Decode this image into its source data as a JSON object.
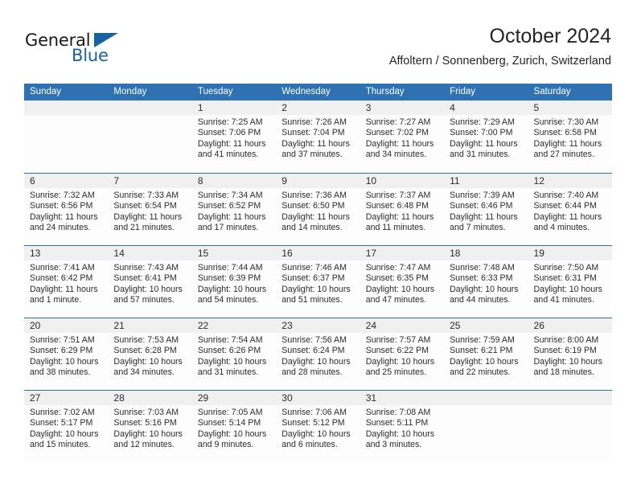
{
  "brand": {
    "name_part1": "General",
    "name_part2": "Blue",
    "accent_color": "#1464a5"
  },
  "header": {
    "title": "October 2024",
    "subtitle": "Affoltern / Sonnenberg, Zurich, Switzerland"
  },
  "theme": {
    "header_blue": "#2f72b4",
    "day_band_gray": "#f0f0f0",
    "text": "#2b2b2b"
  },
  "weekdays": [
    "Sunday",
    "Monday",
    "Tuesday",
    "Wednesday",
    "Thursday",
    "Friday",
    "Saturday"
  ],
  "weeks": [
    [
      {
        "day": "",
        "lines": []
      },
      {
        "day": "",
        "lines": []
      },
      {
        "day": "1",
        "lines": [
          "Sunrise: 7:25 AM",
          "Sunset: 7:06 PM",
          "Daylight: 11 hours",
          "and 41 minutes."
        ]
      },
      {
        "day": "2",
        "lines": [
          "Sunrise: 7:26 AM",
          "Sunset: 7:04 PM",
          "Daylight: 11 hours",
          "and 37 minutes."
        ]
      },
      {
        "day": "3",
        "lines": [
          "Sunrise: 7:27 AM",
          "Sunset: 7:02 PM",
          "Daylight: 11 hours",
          "and 34 minutes."
        ]
      },
      {
        "day": "4",
        "lines": [
          "Sunrise: 7:29 AM",
          "Sunset: 7:00 PM",
          "Daylight: 11 hours",
          "and 31 minutes."
        ]
      },
      {
        "day": "5",
        "lines": [
          "Sunrise: 7:30 AM",
          "Sunset: 6:58 PM",
          "Daylight: 11 hours",
          "and 27 minutes."
        ]
      }
    ],
    [
      {
        "day": "6",
        "lines": [
          "Sunrise: 7:32 AM",
          "Sunset: 6:56 PM",
          "Daylight: 11 hours",
          "and 24 minutes."
        ]
      },
      {
        "day": "7",
        "lines": [
          "Sunrise: 7:33 AM",
          "Sunset: 6:54 PM",
          "Daylight: 11 hours",
          "and 21 minutes."
        ]
      },
      {
        "day": "8",
        "lines": [
          "Sunrise: 7:34 AM",
          "Sunset: 6:52 PM",
          "Daylight: 11 hours",
          "and 17 minutes."
        ]
      },
      {
        "day": "9",
        "lines": [
          "Sunrise: 7:36 AM",
          "Sunset: 6:50 PM",
          "Daylight: 11 hours",
          "and 14 minutes."
        ]
      },
      {
        "day": "10",
        "lines": [
          "Sunrise: 7:37 AM",
          "Sunset: 6:48 PM",
          "Daylight: 11 hours",
          "and 11 minutes."
        ]
      },
      {
        "day": "11",
        "lines": [
          "Sunrise: 7:39 AM",
          "Sunset: 6:46 PM",
          "Daylight: 11 hours",
          "and 7 minutes."
        ]
      },
      {
        "day": "12",
        "lines": [
          "Sunrise: 7:40 AM",
          "Sunset: 6:44 PM",
          "Daylight: 11 hours",
          "and 4 minutes."
        ]
      }
    ],
    [
      {
        "day": "13",
        "lines": [
          "Sunrise: 7:41 AM",
          "Sunset: 6:42 PM",
          "Daylight: 11 hours",
          "and 1 minute."
        ]
      },
      {
        "day": "14",
        "lines": [
          "Sunrise: 7:43 AM",
          "Sunset: 6:41 PM",
          "Daylight: 10 hours",
          "and 57 minutes."
        ]
      },
      {
        "day": "15",
        "lines": [
          "Sunrise: 7:44 AM",
          "Sunset: 6:39 PM",
          "Daylight: 10 hours",
          "and 54 minutes."
        ]
      },
      {
        "day": "16",
        "lines": [
          "Sunrise: 7:46 AM",
          "Sunset: 6:37 PM",
          "Daylight: 10 hours",
          "and 51 minutes."
        ]
      },
      {
        "day": "17",
        "lines": [
          "Sunrise: 7:47 AM",
          "Sunset: 6:35 PM",
          "Daylight: 10 hours",
          "and 47 minutes."
        ]
      },
      {
        "day": "18",
        "lines": [
          "Sunrise: 7:48 AM",
          "Sunset: 6:33 PM",
          "Daylight: 10 hours",
          "and 44 minutes."
        ]
      },
      {
        "day": "19",
        "lines": [
          "Sunrise: 7:50 AM",
          "Sunset: 6:31 PM",
          "Daylight: 10 hours",
          "and 41 minutes."
        ]
      }
    ],
    [
      {
        "day": "20",
        "lines": [
          "Sunrise: 7:51 AM",
          "Sunset: 6:29 PM",
          "Daylight: 10 hours",
          "and 38 minutes."
        ]
      },
      {
        "day": "21",
        "lines": [
          "Sunrise: 7:53 AM",
          "Sunset: 6:28 PM",
          "Daylight: 10 hours",
          "and 34 minutes."
        ]
      },
      {
        "day": "22",
        "lines": [
          "Sunrise: 7:54 AM",
          "Sunset: 6:26 PM",
          "Daylight: 10 hours",
          "and 31 minutes."
        ]
      },
      {
        "day": "23",
        "lines": [
          "Sunrise: 7:56 AM",
          "Sunset: 6:24 PM",
          "Daylight: 10 hours",
          "and 28 minutes."
        ]
      },
      {
        "day": "24",
        "lines": [
          "Sunrise: 7:57 AM",
          "Sunset: 6:22 PM",
          "Daylight: 10 hours",
          "and 25 minutes."
        ]
      },
      {
        "day": "25",
        "lines": [
          "Sunrise: 7:59 AM",
          "Sunset: 6:21 PM",
          "Daylight: 10 hours",
          "and 22 minutes."
        ]
      },
      {
        "day": "26",
        "lines": [
          "Sunrise: 8:00 AM",
          "Sunset: 6:19 PM",
          "Daylight: 10 hours",
          "and 18 minutes."
        ]
      }
    ],
    [
      {
        "day": "27",
        "lines": [
          "Sunrise: 7:02 AM",
          "Sunset: 5:17 PM",
          "Daylight: 10 hours",
          "and 15 minutes."
        ]
      },
      {
        "day": "28",
        "lines": [
          "Sunrise: 7:03 AM",
          "Sunset: 5:16 PM",
          "Daylight: 10 hours",
          "and 12 minutes."
        ]
      },
      {
        "day": "29",
        "lines": [
          "Sunrise: 7:05 AM",
          "Sunset: 5:14 PM",
          "Daylight: 10 hours",
          "and 9 minutes."
        ]
      },
      {
        "day": "30",
        "lines": [
          "Sunrise: 7:06 AM",
          "Sunset: 5:12 PM",
          "Daylight: 10 hours",
          "and 6 minutes."
        ]
      },
      {
        "day": "31",
        "lines": [
          "Sunrise: 7:08 AM",
          "Sunset: 5:11 PM",
          "Daylight: 10 hours",
          "and 3 minutes."
        ]
      },
      {
        "day": "",
        "lines": []
      },
      {
        "day": "",
        "lines": []
      }
    ]
  ]
}
